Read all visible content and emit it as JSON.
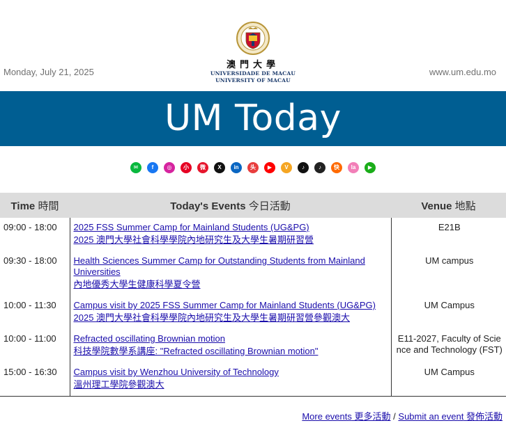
{
  "header": {
    "date": "Monday, July 21, 2025",
    "website": "www.um.edu.mo",
    "logo": {
      "cn": "澳門大學",
      "pt": "UNIVERSIDADE DE MACAU",
      "en": "UNIVERSITY OF MACAU"
    }
  },
  "banner": {
    "title": "UM Today",
    "color": "#005e92"
  },
  "social_icons": [
    {
      "name": "wechat-icon",
      "color": "#09b83e",
      "glyph": "✉"
    },
    {
      "name": "facebook-icon",
      "color": "#1877f2",
      "glyph": "f"
    },
    {
      "name": "instagram-icon",
      "color": "#d6249f",
      "glyph": "◎"
    },
    {
      "name": "xiaohongshu-icon",
      "color": "#e60023",
      "glyph": "小"
    },
    {
      "name": "weibo-icon",
      "color": "#e6162d",
      "glyph": "微"
    },
    {
      "name": "x-icon",
      "color": "#111111",
      "glyph": "X"
    },
    {
      "name": "linkedin-icon",
      "color": "#0a66c2",
      "glyph": "in"
    },
    {
      "name": "toutiao-icon",
      "color": "#e83e3e",
      "glyph": "头"
    },
    {
      "name": "youtube-icon",
      "color": "#ff0000",
      "glyph": "▶"
    },
    {
      "name": "bilibili-icon",
      "color": "#f5a623",
      "glyph": "V"
    },
    {
      "name": "tiktok-icon",
      "color": "#111111",
      "glyph": "♪"
    },
    {
      "name": "douyin-icon",
      "color": "#222222",
      "glyph": "♪"
    },
    {
      "name": "kuaishou-icon",
      "color": "#ff6a00",
      "glyph": "快"
    },
    {
      "name": "lala-icon",
      "color": "#f27fb8",
      "glyph": "la"
    },
    {
      "name": "video-channel-icon",
      "color": "#1aad19",
      "glyph": "▶"
    }
  ],
  "table": {
    "headers": {
      "time": {
        "en": "Time",
        "cn": "時間"
      },
      "events": {
        "en": "Today's Events",
        "cn": "今日活動"
      },
      "venue": {
        "en": "Venue",
        "cn": "地點"
      }
    },
    "rows": [
      {
        "time": "09:00 - 18:00",
        "en": "2025 FSS Summer Camp for Mainland Students (UG&PG)",
        "cn": "2025 澳門大學社會科學學院內地研究生及大學生暑期研習營",
        "venue": "E21B"
      },
      {
        "time": "09:30 - 18:00",
        "en": "Health Sciences Summer Camp for Outstanding Students from Mainland Universities",
        "cn": "內地優秀大學生健康科學夏令營",
        "venue": "UM campus"
      },
      {
        "time": "10:00 - 11:30",
        "en": "Campus visit by 2025 FSS Summer Camp for Mainland Students (UG&PG)",
        "cn": "2025 澳門大學社會科學學院內地研究生及大學生暑期研習營參觀澳大",
        "venue": "UM Campus"
      },
      {
        "time": "10:00 - 11:00",
        "en": "Refracted oscillating Brownian motion",
        "cn": "科技學院數學系講座: \"Refracted oscillating Brownian motion\"",
        "venue": "E11-2027, Faculty of Science and Technology (FST)"
      },
      {
        "time": "15:00 - 16:30",
        "en": "Campus visit by Wenzhou University of Technology",
        "cn": "溫州理工學院參觀澳大",
        "venue": "UM Campus"
      }
    ]
  },
  "footer": {
    "more_en": "More events",
    "more_cn": "更多活動",
    "separator": "/",
    "submit_en": "Submit an event",
    "submit_cn": "發佈活動"
  }
}
